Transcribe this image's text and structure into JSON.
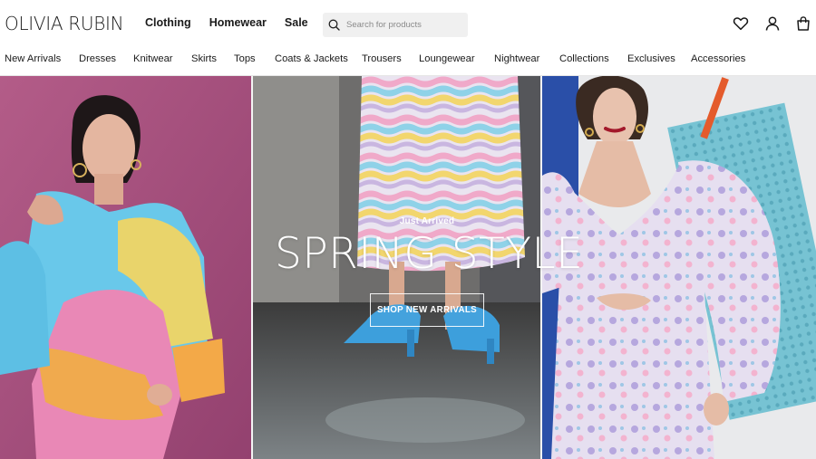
{
  "brand": {
    "logo_text": "OLIVIA RUBIN"
  },
  "primary_nav": [
    {
      "label": "Clothing",
      "active": true
    },
    {
      "label": "Homewear",
      "active": false
    },
    {
      "label": "Sale",
      "active": false
    }
  ],
  "search": {
    "placeholder": "Search for products",
    "value": "",
    "icon": "search-icon"
  },
  "header_icons": [
    "heart-icon",
    "user-icon",
    "bag-icon"
  ],
  "category_nav": [
    "New Arrivals",
    "Dresses",
    "Knitwear",
    "Skirts",
    "Tops",
    "Coats & Jackets",
    "Trousers",
    "Loungewear",
    "Nightwear",
    "Collections",
    "Exclusives",
    "Accessories"
  ],
  "hero": {
    "eyebrow": "Just Arrived",
    "title": "SPRING STYLE",
    "cta_label": "SHOP NEW ARRIVALS"
  },
  "colors": {
    "nav_active_highlight": "#e978be",
    "search_bg": "#f0f0f0",
    "left_backdrop": "#a8527f",
    "right_backdrop": "#2a4fa8"
  }
}
